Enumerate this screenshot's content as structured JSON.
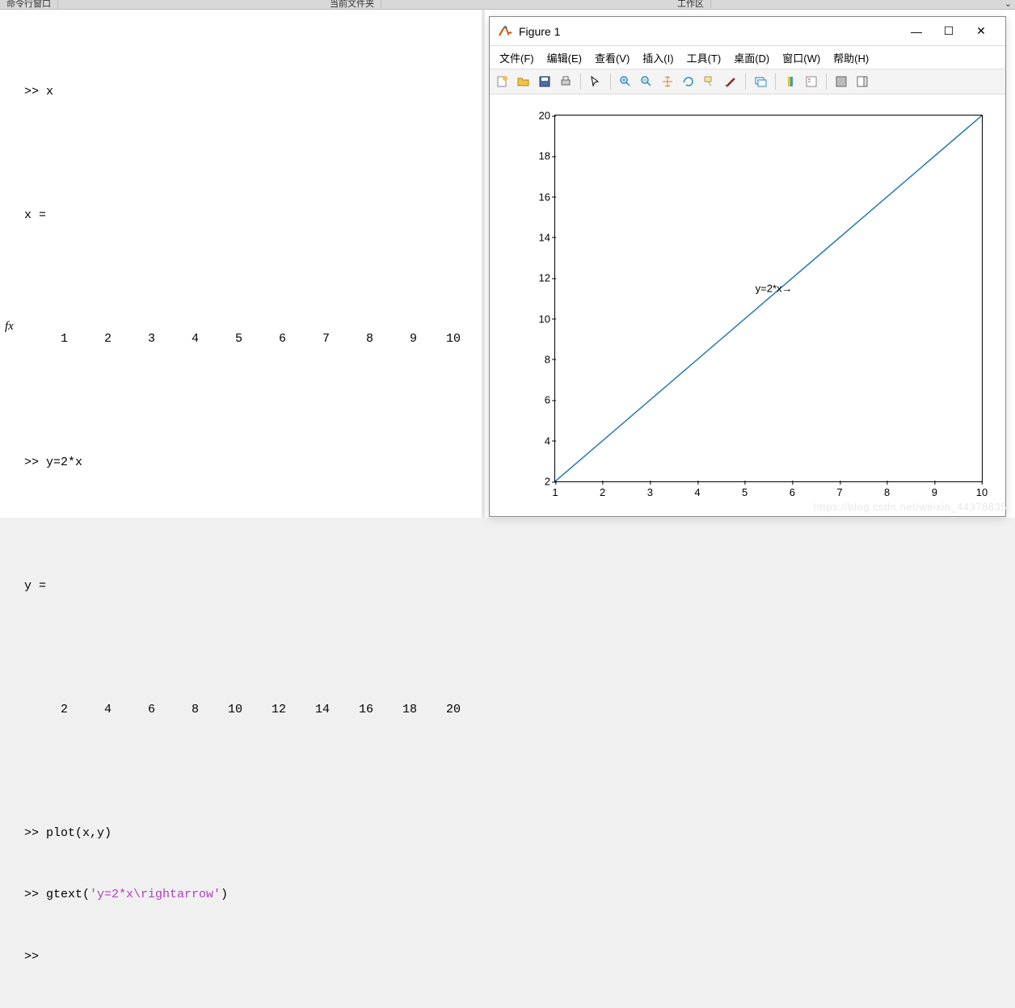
{
  "top": {
    "cmd_label": "命令行窗口",
    "curdir_label": "当前文件夹",
    "workspace_label": "工作区"
  },
  "cmd": {
    "fx": "fx",
    "l1": ">> x",
    "l2": "x =",
    "x_vec": [
      "1",
      "2",
      "3",
      "4",
      "5",
      "6",
      "7",
      "8",
      "9",
      "10"
    ],
    "l3": ">> y=2*x",
    "l4": "y =",
    "y_vec": [
      "2",
      "4",
      "6",
      "8",
      "10",
      "12",
      "14",
      "16",
      "18",
      "20"
    ],
    "l5": ">> plot(x,y)",
    "l6a": ">> gtext(",
    "l6b": "'y=2*x\\rightarrow'",
    "l6c": ")",
    "l7": ">> "
  },
  "fig": {
    "title": "Figure 1",
    "menu": {
      "file": "文件(F)",
      "edit": "编辑(E)",
      "view": "查看(V)",
      "insert": "插入(I)",
      "tools": "工具(T)",
      "desktop": "桌面(D)",
      "window": "窗口(W)",
      "help": "帮助(H)"
    },
    "annotation": "y=2*x→"
  },
  "chart_data": {
    "type": "line",
    "x": [
      1,
      2,
      3,
      4,
      5,
      6,
      7,
      8,
      9,
      10
    ],
    "y": [
      2,
      4,
      6,
      8,
      10,
      12,
      14,
      16,
      18,
      20
    ],
    "xlim": [
      1,
      10
    ],
    "ylim": [
      2,
      20
    ],
    "xticks": [
      1,
      2,
      3,
      4,
      5,
      6,
      7,
      8,
      9,
      10
    ],
    "yticks": [
      2,
      4,
      6,
      8,
      10,
      12,
      14,
      16,
      18,
      20
    ],
    "annotation": {
      "text": "y=2*x→",
      "x": 5.3,
      "y": 11.5
    }
  },
  "watermark": "https://blog.csdn.net/weixin_44378835"
}
